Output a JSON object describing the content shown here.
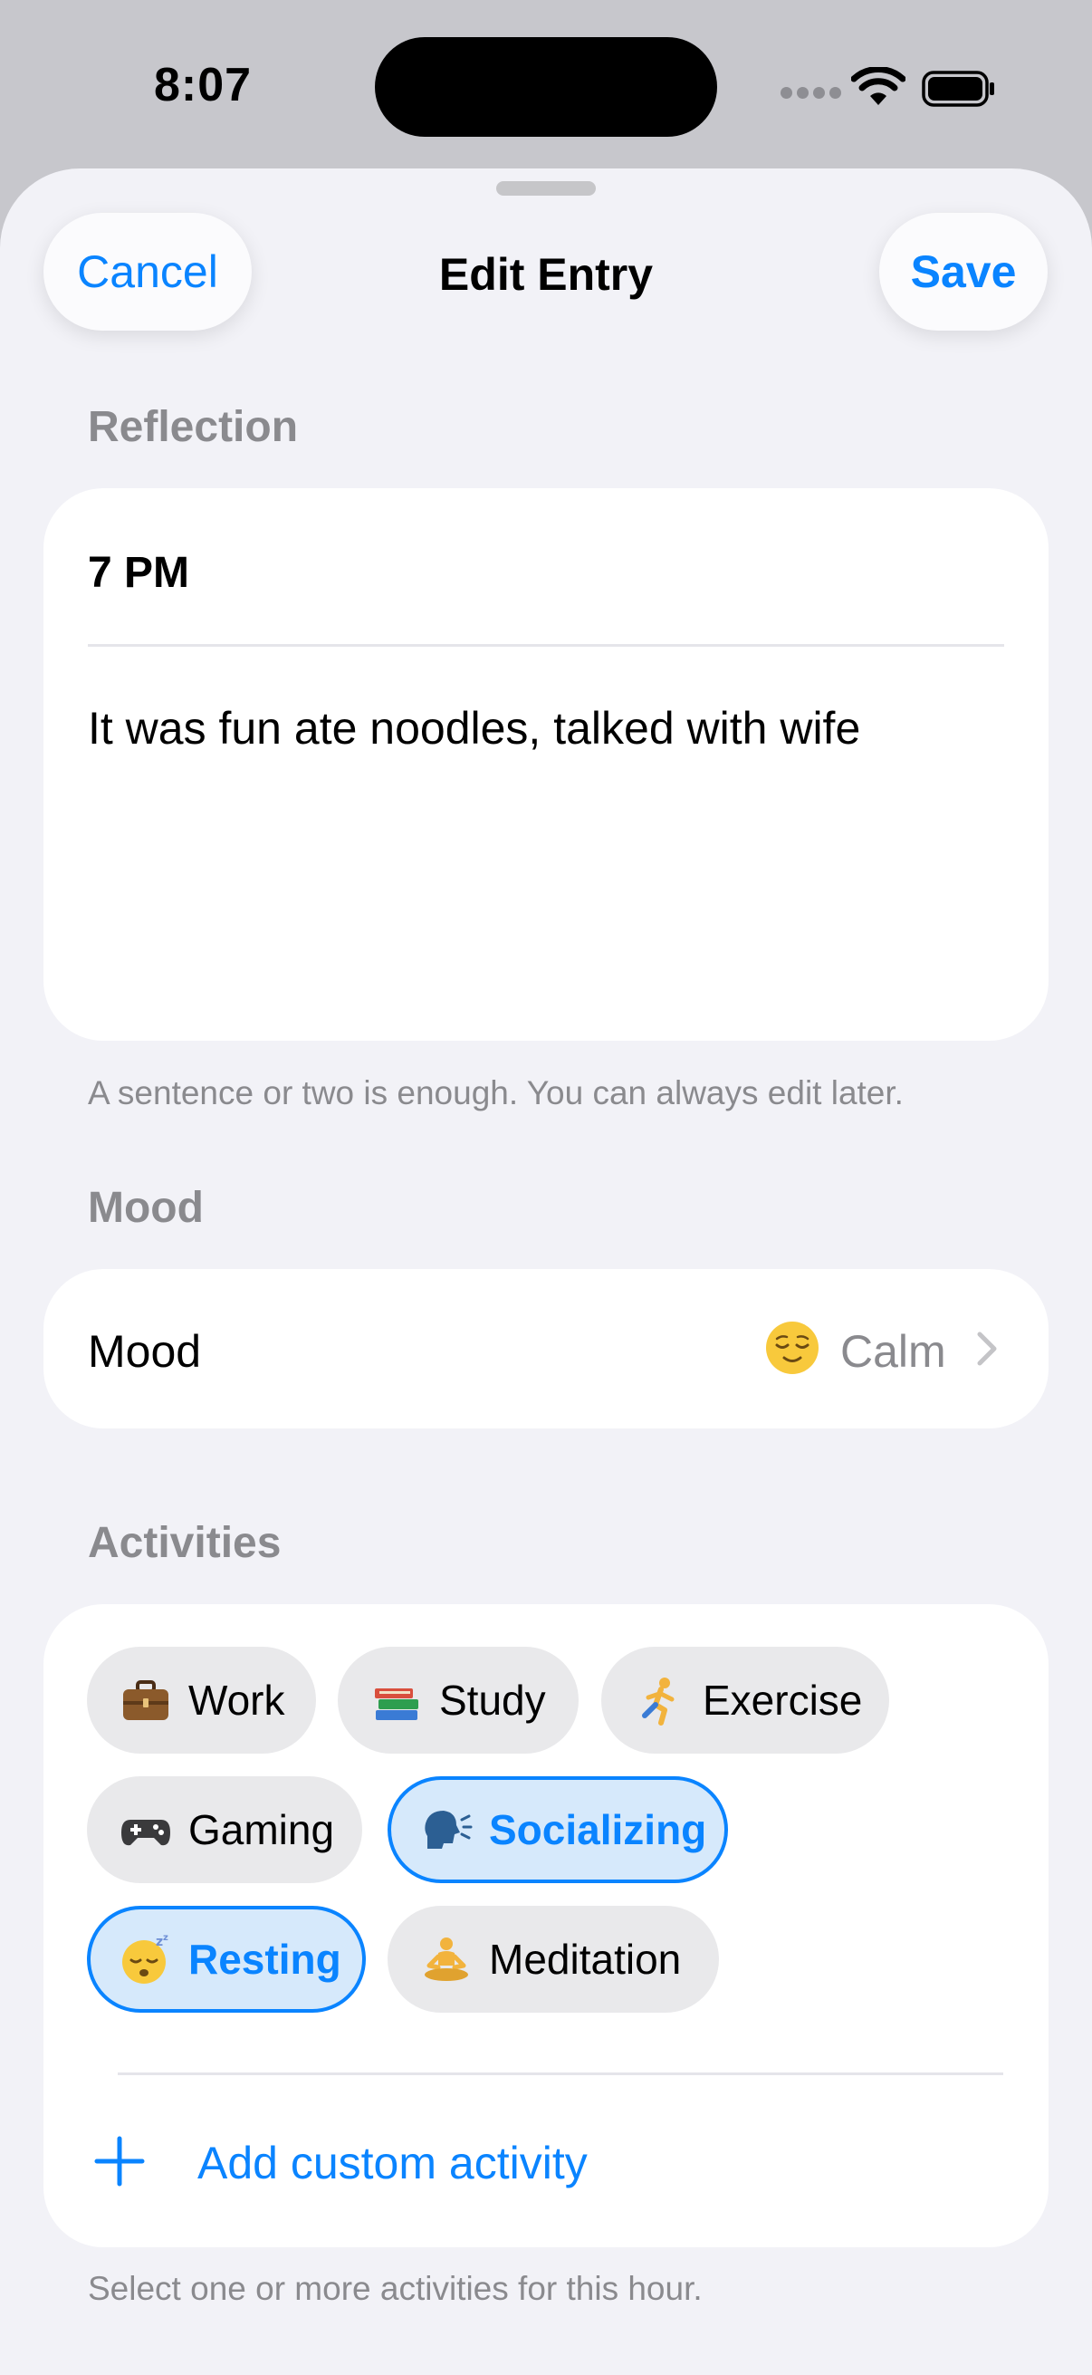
{
  "status_bar": {
    "time": "8:07"
  },
  "nav": {
    "cancel_label": "Cancel",
    "title": "Edit Entry",
    "save_label": "Save"
  },
  "reflection": {
    "header": "Reflection",
    "time": "7 PM",
    "text": "It was fun ate noodles, talked with wife",
    "footer": "A sentence or two is enough. You can always edit later."
  },
  "mood": {
    "header": "Mood",
    "label": "Mood",
    "emoji_icon": "relieved-face-emoji",
    "value": "Calm"
  },
  "activities": {
    "header": "Activities",
    "chips": [
      {
        "label": "Work",
        "icon": "briefcase-icon",
        "selected": false
      },
      {
        "label": "Study",
        "icon": "books-icon",
        "selected": false
      },
      {
        "label": "Exercise",
        "icon": "runner-icon",
        "selected": false
      },
      {
        "label": "Gaming",
        "icon": "game-controller-icon",
        "selected": false
      },
      {
        "label": "Socializing",
        "icon": "speaking-head-icon",
        "selected": true
      },
      {
        "label": "Resting",
        "icon": "sleeping-face-icon",
        "selected": true
      },
      {
        "label": "Meditation",
        "icon": "meditation-icon",
        "selected": false
      }
    ],
    "add_label": "Add custom activity",
    "footer": "Select one or more activities for this hour."
  },
  "colors": {
    "accent": "#0a84ff",
    "secondary_text": "#8a8a8e",
    "background": "#f2f2f7"
  }
}
